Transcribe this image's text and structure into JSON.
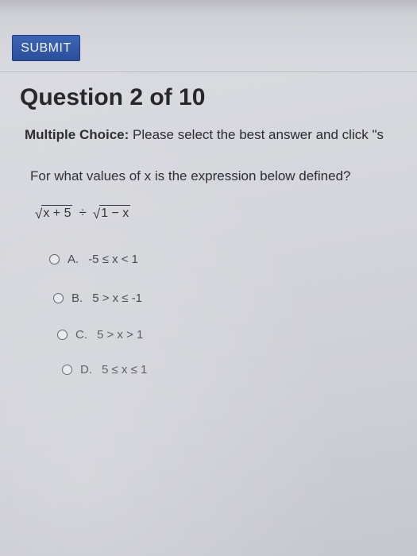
{
  "header": {
    "submit_label": "SUBMIT"
  },
  "question": {
    "title": "Question 2 of 10",
    "instructions_label": "Multiple Choice:",
    "instructions_text": "Please select the best answer and click \"s",
    "prompt": "For what values of x is the expression below defined?",
    "expression": {
      "left_radicand": "x + 5",
      "operator": "÷",
      "right_radicand": "1 − x"
    }
  },
  "choices": [
    {
      "letter": "A.",
      "text": "-5 ≤ x < 1"
    },
    {
      "letter": "B.",
      "text": "5 > x ≤ -1"
    },
    {
      "letter": "C.",
      "text": "5 > x > 1"
    },
    {
      "letter": "D.",
      "text": "5 ≤ x ≤ 1"
    }
  ]
}
